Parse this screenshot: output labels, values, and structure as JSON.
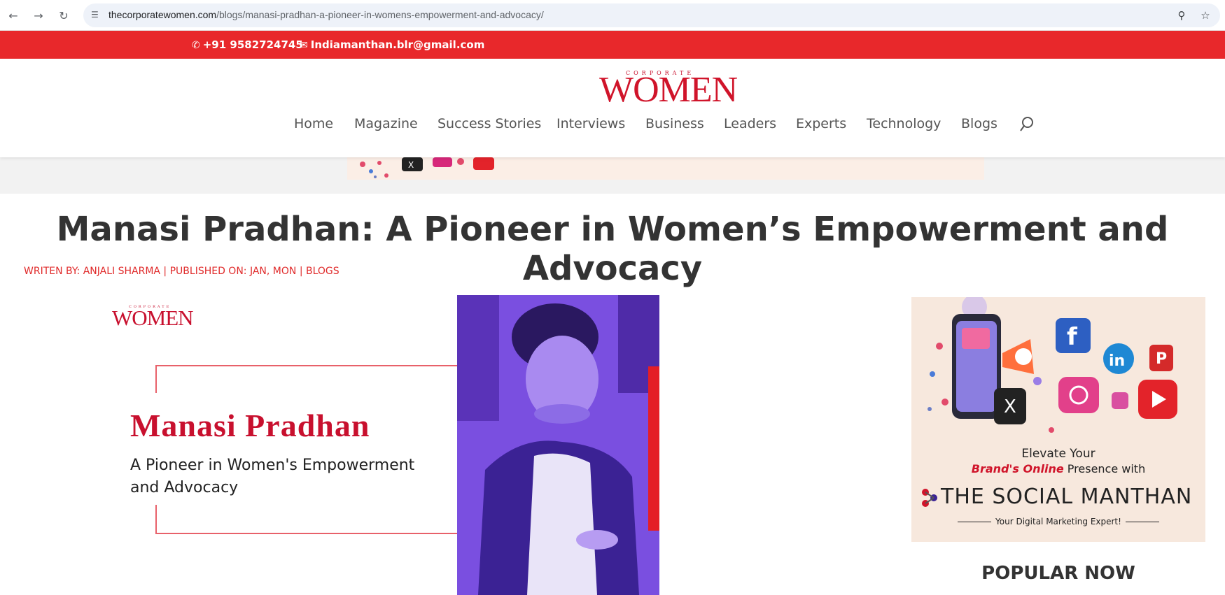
{
  "browser": {
    "url_host": "thecorporatewomen.com",
    "url_path": "/blogs/manasi-pradhan-a-pioneer-in-womens-empowerment-and-advocacy/"
  },
  "topbar": {
    "phone": "+91 9582724745",
    "email": "Indiamanthan.blr@gmail.com",
    "bg_color": "#e8282b"
  },
  "logo": {
    "small": "CORPORATE",
    "big": "WOMEN"
  },
  "menu": {
    "items": [
      "Home",
      "Magazine",
      "Success Stories",
      "Interviews",
      "Business",
      "Leaders",
      "Experts",
      "Technology",
      "Blogs"
    ]
  },
  "article": {
    "title": "Manasi Pradhan: A Pioneer in Women’s Empowerment and Advocacy",
    "meta": "WRITEN BY: ANJALI SHARMA |   PUBLISHED ON: JAN, MON |   BLOGS"
  },
  "feature": {
    "logo_small": "CORPORATE",
    "logo_big": "WOMEN",
    "name": "Manasi Pradhan",
    "subtitle": "A Pioneer in Women's Empowerment and Advocacy"
  },
  "ad": {
    "line1": "Elevate Your",
    "line2_highlight": "Brand's Online",
    "line2_rest": " Presence with",
    "brand": "THE SOCIAL MANTHAN",
    "tagline": "Your Digital Marketing Expert!"
  },
  "sidebar": {
    "popular_heading": "POPULAR NOW"
  }
}
